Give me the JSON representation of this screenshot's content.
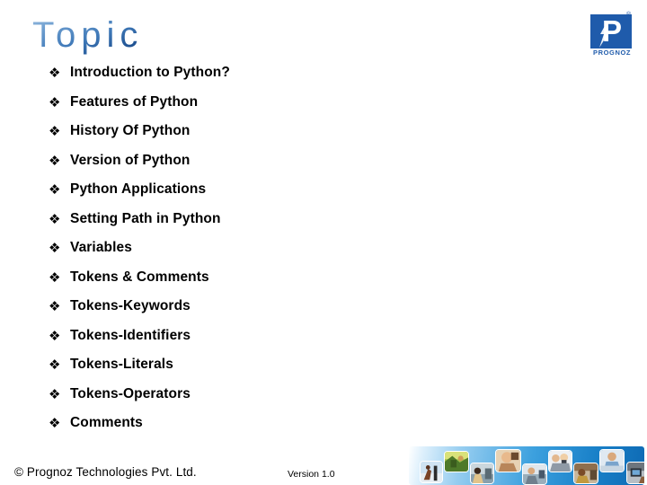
{
  "slide": {
    "title": "Topic",
    "bullet_glyph": "❖",
    "bullets": [
      {
        "label": "Introduction to Python?"
      },
      {
        "label": "Features of Python"
      },
      {
        "label": "History Of Python"
      },
      {
        "label": "Version of Python"
      },
      {
        "label": "Python Applications"
      },
      {
        "label": "Setting Path in Python"
      },
      {
        "label": "Variables"
      },
      {
        "label": "Tokens & Comments"
      },
      {
        "label": "Tokens-Keywords"
      },
      {
        "label": "Tokens-Identifiers"
      },
      {
        "label": "Tokens-Literals"
      },
      {
        "label": "Tokens-Operators"
      },
      {
        "label": "Comments"
      }
    ]
  },
  "footer": {
    "copyright": "© Prognoz Technologies Pvt. Ltd.",
    "version": "Version 1.0"
  },
  "logo": {
    "mark_letter": "P",
    "wordmark": "PROGNOZ",
    "registered": "®",
    "brand_color": "#1f5bab"
  },
  "photo_banner": {
    "thumbnail_count": 9,
    "gradient_from": "#ffffff",
    "gradient_to": "#0e6ab4"
  },
  "colors": {
    "title_gradient_light": "#9cbfe0",
    "title_gradient_dark": "#163c72",
    "text": "#000000",
    "background": "#ffffff"
  }
}
